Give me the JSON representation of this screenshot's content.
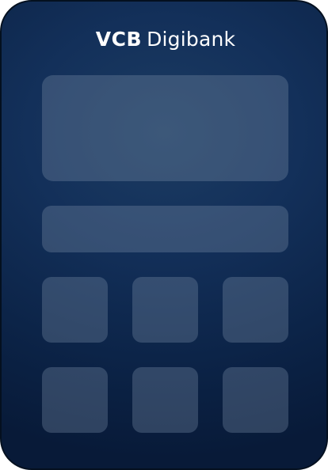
{
  "app": {
    "logo": {
      "brand": "VCB",
      "product": "Digibank"
    }
  },
  "colors": {
    "background_top": "#1c3c62",
    "background_bottom": "#081a38",
    "placeholder": "#3a5070",
    "logo_text": "#ffffff"
  },
  "loading_state": {
    "placeholder_blocks": [
      "banner-placeholder",
      "bar-placeholder",
      "tile-placeholder-1",
      "tile-placeholder-2",
      "tile-placeholder-3",
      "tile-placeholder-4",
      "tile-placeholder-5",
      "tile-placeholder-6"
    ]
  }
}
